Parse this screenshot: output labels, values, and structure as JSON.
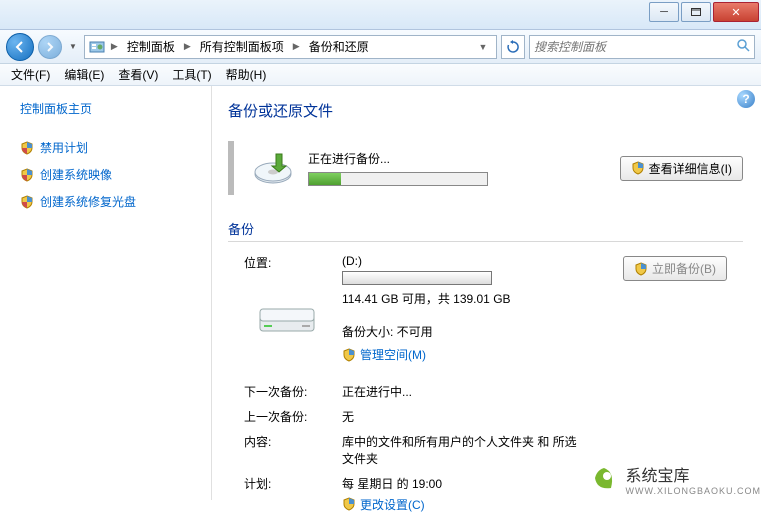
{
  "titlebar": {
    "min": "─",
    "close": "✕"
  },
  "breadcrumb": {
    "p1": "控制面板",
    "p2": "所有控制面板项",
    "p3": "备份和还原"
  },
  "search": {
    "placeholder": "搜索控制面板"
  },
  "menu": {
    "file": "文件(F)",
    "edit": "编辑(E)",
    "view": "查看(V)",
    "tools": "工具(T)",
    "help": "帮助(H)"
  },
  "sidebar": {
    "home": "控制面板主页",
    "tasks": [
      "禁用计划",
      "创建系统映像",
      "创建系统修复光盘"
    ]
  },
  "main": {
    "heading": "备份或还原文件",
    "progress_label": "正在进行备份...",
    "details_btn": "查看详细信息(I)",
    "section": "备份",
    "backup_now": "立即备份(B)",
    "rows": {
      "location_k": "位置:",
      "location_v": "(D:)",
      "disk_free": "114.41 GB 可用，共 139.01 GB",
      "size_label": "备份大小: 不可用",
      "manage": "管理空间(M)",
      "next_k": "下一次备份:",
      "next_v": "正在进行中...",
      "last_k": "上一次备份:",
      "last_v": "无",
      "content_k": "内容:",
      "content_v": "库中的文件和所有用户的个人文件夹 和 所选文件夹",
      "plan_k": "计划:",
      "plan_v": "每 星期日 的 19:00",
      "change": "更改设置(C)"
    }
  },
  "watermark": {
    "title": "系统宝库",
    "url": "WWW.XILONGBAOKU.COM"
  }
}
